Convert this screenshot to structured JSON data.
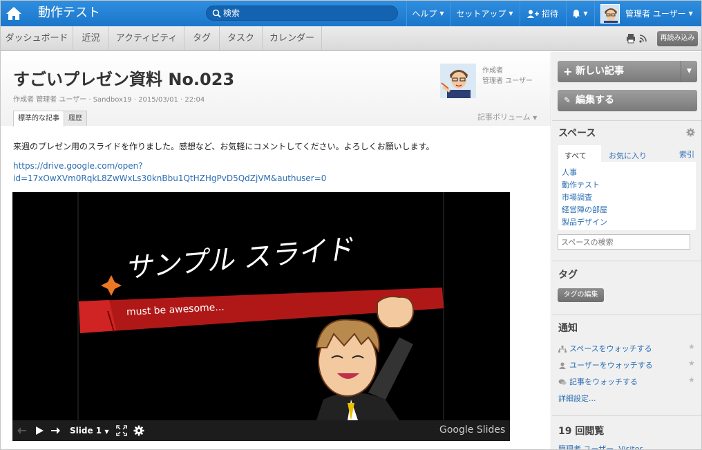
{
  "topbar": {
    "app_name": "動作テスト",
    "search_placeholder": "検索",
    "help_label": "ヘルプ",
    "setup_label": "セットアップ",
    "invite_label": "招待",
    "user_label": "管理者 ユーザー",
    "accent": "#1b76c9"
  },
  "subnav": {
    "items": [
      "ダッシュボード",
      "近況",
      "アクティビティ",
      "タグ",
      "タスク",
      "カレンダー"
    ],
    "reload_label": "再読み込み"
  },
  "post": {
    "title": "すごいプレゼン資料 No.023",
    "meta": "作成者 管理者 ユーザー · Sandbox19 · 2015/03/01 · 22:04",
    "author_label": "作成者",
    "author_name": "管理者 ユーザー",
    "tab_standard": "標準的な記事",
    "tab_history": "履歴",
    "volume_label": "記事ボリューム",
    "body": "来週のプレゼン用のスライドを作りました。感想など、お気軽にコメントしてください。よろしくお願いします。",
    "link_line1": "https://drive.google.com/open?",
    "link_line2": "id=17xOwXVm0RqkL8ZwWxLs30knBbu1QtHZHgPvD5QdZjVM&authuser=0"
  },
  "slide": {
    "title": "サンプル スライド",
    "subtitle": "must be awesome...",
    "slide_label": "Slide 1",
    "brand": "Google Slides"
  },
  "sidebar": {
    "new_post": "新しい記事",
    "edit": "編集する",
    "space_heading": "スペース",
    "tab_all": "すべて",
    "tab_fav": "お気に入り",
    "index": "索引",
    "spaces": [
      "人事",
      "動作テスト",
      "市場調査",
      "経営陣の部屋",
      "製品デザイン"
    ],
    "space_search_placeholder": "スペースの検索",
    "tag_heading": "タグ",
    "tag_edit": "タグの編集",
    "notif_heading": "通知",
    "watch_space": "スペースをウォッチする",
    "watch_user": "ユーザーをウォッチする",
    "watch_post": "記事をウォッチする",
    "detail": "詳細設定...",
    "views": "19 回閲覧",
    "viewers": "管理者 ユーザー, Visitor"
  }
}
